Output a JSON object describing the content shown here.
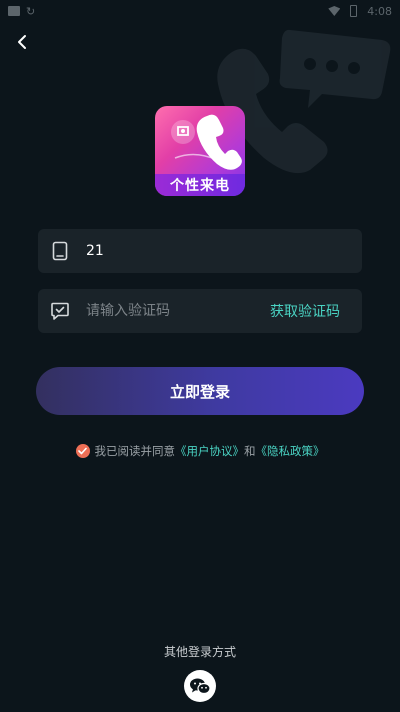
{
  "status_bar": {
    "time": "4:08"
  },
  "header": {
    "back_icon": "chevron-left-icon"
  },
  "logo": {
    "text": "个性来电",
    "icon": "phone-icon"
  },
  "phone_field": {
    "value": "21",
    "icon": "phone-device-icon"
  },
  "code_field": {
    "placeholder": "请输入验证码",
    "icon": "message-check-icon",
    "get_code_label": "获取验证码"
  },
  "login_button": {
    "label": "立即登录"
  },
  "agreement": {
    "checked": true,
    "prefix": "我已阅读并同意",
    "user_agreement": "《用户协议》",
    "conjunction": "和",
    "privacy_policy": "《隐私政策》"
  },
  "other_login": {
    "label": "其他登录方式",
    "wechat_icon": "wechat-icon"
  },
  "colors": {
    "background": "#0c151b",
    "field_bg": "#1a2329",
    "accent": "#4ad3c3",
    "button_start": "#33305f",
    "button_end": "#4b3ac0",
    "checkbox": "#ee6f56"
  }
}
